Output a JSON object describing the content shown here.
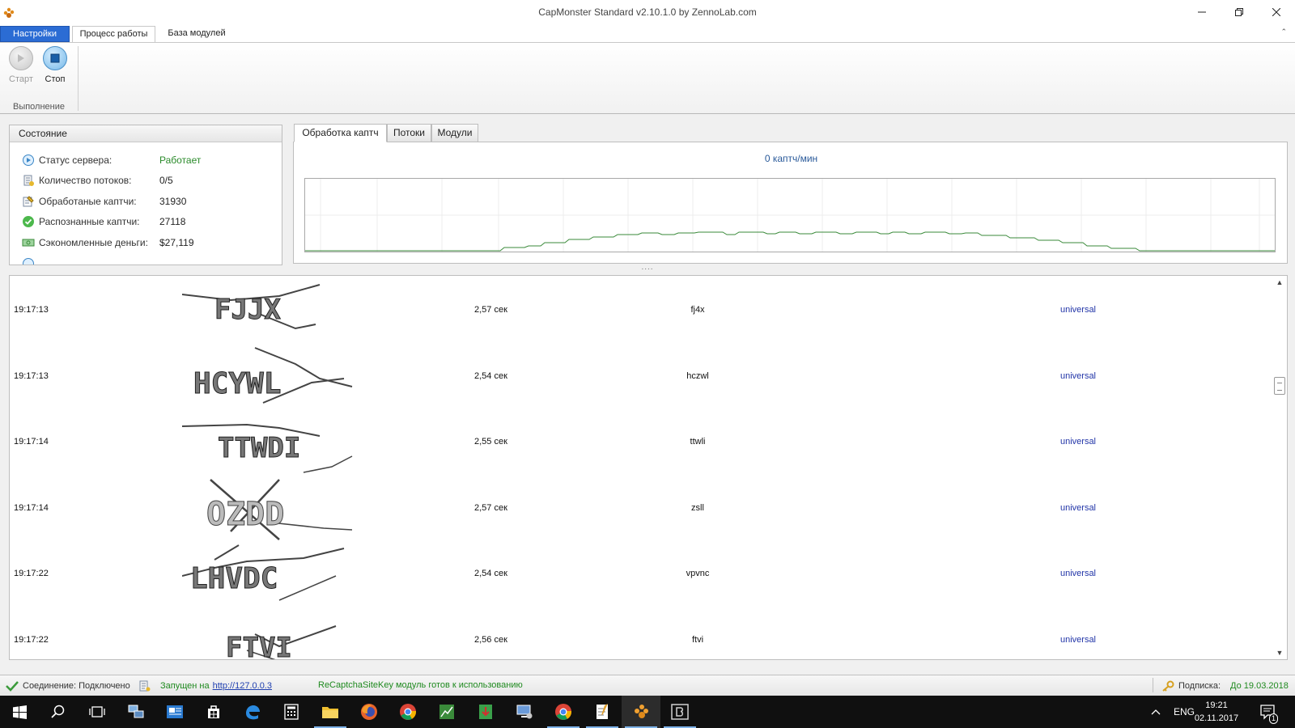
{
  "window": {
    "title": "CapMonster Standard v2.10.1.0 by ZennoLab.com"
  },
  "ribbon": {
    "tabs": [
      {
        "label": "Настройки"
      },
      {
        "label": "Процесс работы"
      },
      {
        "label": "База модулей"
      }
    ],
    "start_label": "Старт",
    "stop_label": "Стоп",
    "group_label": "Выполнение"
  },
  "status_panel": {
    "title": "Состояние",
    "rows": [
      {
        "label": "Статус сервера:",
        "value": "Работает",
        "icon": "server-status-icon"
      },
      {
        "label": "Количество потоков:",
        "value": "0/5",
        "icon": "threads-icon"
      },
      {
        "label": "Обработаные каптчи:",
        "value": "31930",
        "icon": "processed-icon"
      },
      {
        "label": "Распознанные каптчи:",
        "value": "27118",
        "icon": "recognized-icon"
      },
      {
        "label": "Сэкономленные деньги:",
        "value": "$27,119",
        "icon": "money-icon"
      }
    ]
  },
  "chart_panel": {
    "tabs": [
      {
        "label": "Обработка каптч"
      },
      {
        "label": "Потоки"
      },
      {
        "label": "Модули"
      }
    ],
    "rate_text": "0 каптч/мин"
  },
  "log": [
    {
      "time": "19:17:13",
      "duration": "2,57 сек",
      "answer": "fj4x",
      "module": "universal"
    },
    {
      "time": "19:17:13",
      "duration": "2,54 сек",
      "answer": "hczwl",
      "module": "universal"
    },
    {
      "time": "19:17:14",
      "duration": "2,55 сек",
      "answer": "ttwli",
      "module": "universal"
    },
    {
      "time": "19:17:14",
      "duration": "2,57 сек",
      "answer": "zsll",
      "module": "universal"
    },
    {
      "time": "19:17:22",
      "duration": "2,54 сек",
      "answer": "vpvnc",
      "module": "universal"
    },
    {
      "time": "19:17:22",
      "duration": "2,56 сек",
      "answer": "ftvi",
      "module": "universal"
    }
  ],
  "statusbar": {
    "connection": "Соединение: Подключено",
    "running_prefix": "Запущен на",
    "running_url": "http://127.0.0.3",
    "recaptcha": "ReCaptchaSiteKey модуль готов к использованию",
    "subscription_label": "Подписка:",
    "subscription_until": "До 19.03.2018"
  },
  "taskbar": {
    "lang": "ENG",
    "time": "19:21",
    "date": "02.11.2017",
    "notification_count": "1"
  },
  "colors": {
    "accent": "#2b6cd4",
    "ok_green": "#2a8a2a",
    "module_link": "#2235a8",
    "chart_line": "#3a8a3a"
  }
}
